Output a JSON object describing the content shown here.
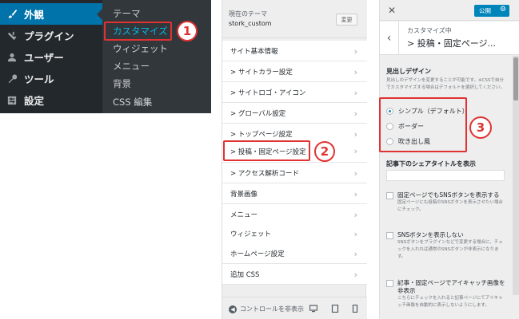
{
  "admin_menu": {
    "items": [
      {
        "label": "外観",
        "icon": "paintbrush-icon",
        "active": true
      },
      {
        "label": "プラグイン",
        "icon": "plugin-icon"
      },
      {
        "label": "ユーザー",
        "icon": "user-icon"
      },
      {
        "label": "ツール",
        "icon": "wrench-icon"
      },
      {
        "label": "設定",
        "icon": "settings-icon"
      }
    ],
    "submenu": [
      "テーマ",
      "カスタマイズ",
      "ウィジェット",
      "メニュー",
      "背景",
      "CSS 編集"
    ]
  },
  "customizer": {
    "current_theme_label": "現在のテーマ",
    "theme_name": "stork_custom",
    "change_button": "変更",
    "sections": [
      "サイト基本情報",
      "> サイトカラー設定",
      "> サイトロゴ・アイコン",
      "> グローバル設定",
      "> トップページ設定",
      "> 投稿・固定ページ設定",
      "> アクセス解析コード",
      "背景画像",
      "メニュー",
      "ウィジェット",
      "ホームページ設定",
      "追加 CSS"
    ],
    "hide_controls": "コントロールを非表示"
  },
  "detail": {
    "publish_button": "公開",
    "breadcrumb": "カスタマイズ中",
    "title": "> 投稿・固定ページ...",
    "heading_label": "見出しデザイン",
    "heading_desc": "見出しのデザインを変更することが可能です。※CSSで自分でカスタマイズする場合はデフォルトを選択してください。",
    "radios": [
      "シンプル（デフォルト）",
      "ボーダー",
      "吹き出し風"
    ],
    "share_title_label": "記事下のシェアタイトルを表示",
    "checks": [
      {
        "label": "固定ページでもSNSボタンを表示する",
        "desc": "固定ページにも投稿のSNSボタンを表示させたい場合にチェック。"
      },
      {
        "label": "SNSボタンを表示しない",
        "desc": "SNSボタンをプラグインなどで変更する場合に、チェックを入れれば通常のSNSボタンが非表示になります。"
      },
      {
        "label": "記事・固定ページでアイキャッチ画像を非表示",
        "desc": "こちらにチェックを入れると記事ページにてアイキャッチ画像を自動的に表示しないようにします。"
      }
    ]
  },
  "annotations": [
    "1",
    "2",
    "3"
  ],
  "colors": {
    "admin_bg": "#23282d",
    "admin_active": "#0073aa",
    "highlight": "#e03232",
    "publish": "#0085ba"
  }
}
